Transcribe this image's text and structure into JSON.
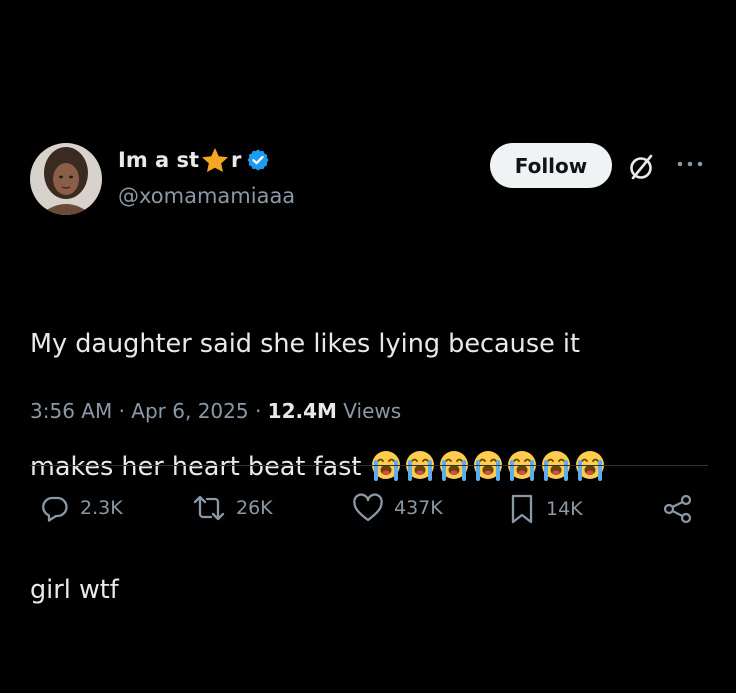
{
  "author": {
    "display_name_before": "Im a st",
    "display_name_after": "r",
    "star_icon": "star-icon",
    "verified_icon": "verified-badge-icon",
    "handle": "@xomamamiaaa",
    "verified_color": "#1d9bf0",
    "star_color": "#f5a623"
  },
  "header": {
    "follow_label": "Follow",
    "grok_icon": "grok-icon",
    "more_icon": "more-options-icon"
  },
  "tweet": {
    "line1": "My daughter said she likes lying because it",
    "line2": "makes her heart beat fast",
    "line3": "girl wtf",
    "emoji_name": "loudly-crying-face-icon",
    "emoji_count": 7
  },
  "meta": {
    "time": "3:56 AM",
    "separator": "·",
    "date": "Apr 6, 2025",
    "views_count": "12.4M",
    "views_label": "Views"
  },
  "actions": {
    "replies": "2.3K",
    "reposts": "26K",
    "likes": "437K",
    "bookmarks": "14K"
  },
  "colors": {
    "background": "#000000",
    "text_primary": "#e7e9ea",
    "text_secondary": "#8b98a5",
    "divider": "#2f3336"
  }
}
